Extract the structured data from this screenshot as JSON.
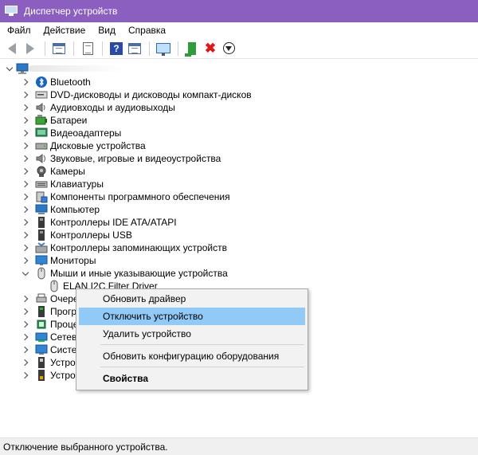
{
  "window": {
    "title": "Диспетчер устройств"
  },
  "menubar": [
    {
      "label": "Файл"
    },
    {
      "label": "Действие"
    },
    {
      "label": "Вид"
    },
    {
      "label": "Справка"
    }
  ],
  "tree": {
    "categories": [
      {
        "label": "Bluetooth",
        "icon": "bluetooth-icon"
      },
      {
        "label": "DVD-дисководы и дисководы компакт-дисков",
        "icon": "dvd-drive-icon"
      },
      {
        "label": "Аудиовходы и аудиовыходы",
        "icon": "speaker-icon"
      },
      {
        "label": "Батареи",
        "icon": "battery-icon"
      },
      {
        "label": "Видеоадаптеры",
        "icon": "display-adapter-icon"
      },
      {
        "label": "Дисковые устройства",
        "icon": "disk-drive-icon"
      },
      {
        "label": "Звуковые, игровые и видеоустройства",
        "icon": "sound-icon"
      },
      {
        "label": "Камеры",
        "icon": "camera-icon"
      },
      {
        "label": "Клавиатуры",
        "icon": "keyboard-icon"
      },
      {
        "label": "Компоненты программного обеспечения",
        "icon": "software-component-icon"
      },
      {
        "label": "Компьютер",
        "icon": "computer-icon"
      },
      {
        "label": "Контроллеры IDE ATA/ATAPI",
        "icon": "ide-controller-icon"
      },
      {
        "label": "Контроллеры USB",
        "icon": "usb-controller-icon"
      },
      {
        "label": "Контроллеры запоминающих устройств",
        "icon": "storage-controller-icon"
      },
      {
        "label": "Мониторы",
        "icon": "monitor-icon"
      },
      {
        "label": "Мыши и иные указывающие устройства",
        "icon": "mouse-icon",
        "expanded": true
      },
      {
        "label": "ELAN I2C Filter Driver",
        "icon": "mouse-icon",
        "child": true
      },
      {
        "label": "Очере",
        "icon": "print-queue-icon"
      },
      {
        "label": "Прогр",
        "icon": "software-device-icon"
      },
      {
        "label": "Проце",
        "icon": "processor-icon"
      },
      {
        "label": "Сетев",
        "icon": "network-adapter-icon"
      },
      {
        "label": "Систе",
        "icon": "system-device-icon"
      },
      {
        "label": "Устро",
        "icon": "hid-icon"
      },
      {
        "label": "Устро",
        "icon": "usb-device-icon"
      }
    ]
  },
  "context_menu": {
    "items": [
      {
        "label": "Обновить драйвер"
      },
      {
        "label": "Отключить устройство",
        "highlighted": true
      },
      {
        "label": "Удалить устройство"
      },
      {
        "label": "Обновить конфигурацию оборудования"
      },
      {
        "label": "Свойства",
        "bold": true
      }
    ]
  },
  "statusbar": {
    "text": "Отключение выбранного устройства."
  },
  "colors": {
    "titlebar": "#8a5fbf",
    "menu_highlight": "#91c9f7",
    "status_bg": "#f0f0f0"
  }
}
